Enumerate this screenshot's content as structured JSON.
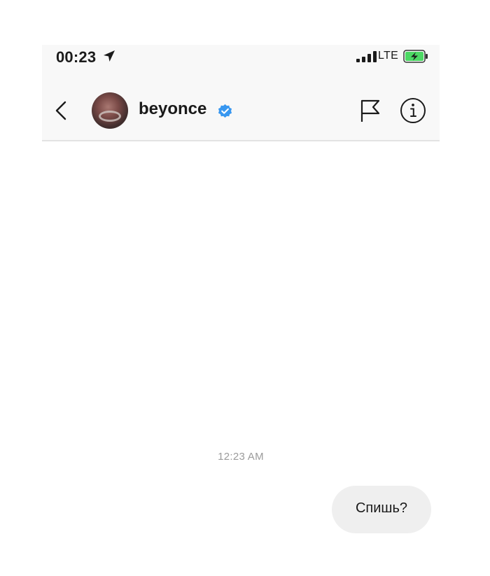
{
  "status_bar": {
    "time": "00:23",
    "network": "LTE",
    "icons": [
      "location-arrow-icon",
      "signal-bars-icon",
      "battery-charging-icon"
    ]
  },
  "header": {
    "back_icon": "chevron-left-icon",
    "username": "beyonce",
    "verified_icon": "verified-badge-icon",
    "actions": [
      "flag-icon",
      "info-icon"
    ]
  },
  "conversation": {
    "timestamp": "12:23 AM",
    "messages": [
      {
        "text": "Спишь?",
        "sender": "me"
      }
    ]
  },
  "colors": {
    "header_background": "#f8f8f8",
    "verified_blue": "#3897f0",
    "battery_green": "#4cd964",
    "bubble_background": "#efefef",
    "timestamp_gray": "#9b9b9b"
  }
}
